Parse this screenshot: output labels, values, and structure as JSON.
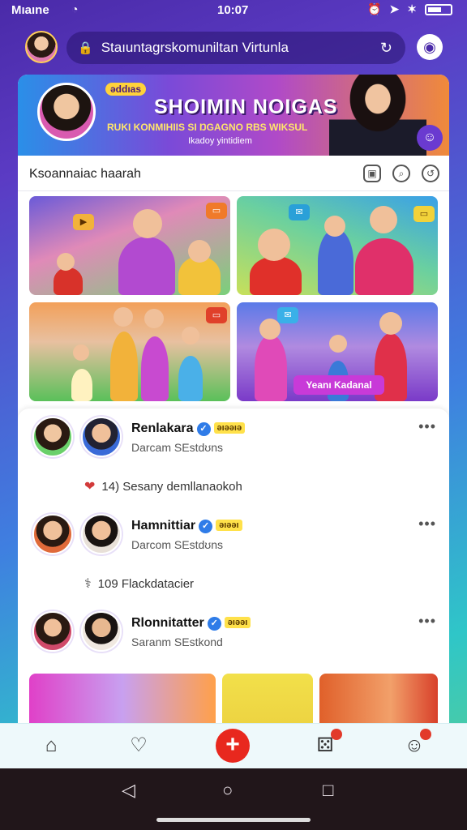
{
  "status_bar": {
    "carrier": "Mıaıne",
    "time": "10:07"
  },
  "top_bar": {
    "search_text": "Staıuntagrskomuniltan Virtunla"
  },
  "banner": {
    "brand_badge": "ǝddıas",
    "title": "SHOIMIN NOIGAS",
    "subtitle": "RUKI KONMIHIIS SI ŊGAGNO RBS WIKSUL",
    "tagline": "Ikadoy yintidiem"
  },
  "section": {
    "label": "Ksoannaiac haarah"
  },
  "tiles": [
    {
      "caption": ""
    },
    {
      "caption": ""
    },
    {
      "caption": ""
    },
    {
      "caption": "Yeanı Kadanal"
    }
  ],
  "posts": [
    {
      "name": "Renlakara",
      "tag": "ǝıǝəıǝ",
      "meta": "Darcam SEstdʊns",
      "stat": "14) Sesany demllanaokoh"
    },
    {
      "name": "Hamnittiar",
      "tag": "ǝıǝəı",
      "meta": "Darcom SEstdʊns",
      "stat": "109 Flackdatacier"
    },
    {
      "name": "Rlonnitatter",
      "tag": "ǝıǝəı",
      "meta": "Saranm SEstkond",
      "stat": ""
    }
  ],
  "colors": {
    "accent": "#4a2aa8",
    "add_button": "#e8281e",
    "verified": "#2f7ce8",
    "tag": "#ffe14a"
  },
  "icons": {
    "status": [
      "wifi-icon",
      "alarm-icon",
      "location-arrow-icon",
      "signal-icon",
      "battery-icon"
    ],
    "nav": [
      "home-icon",
      "chat-heart-icon",
      "add-icon",
      "dice-icon",
      "profile-icon"
    ],
    "system": [
      "back-icon",
      "home-circle-icon",
      "recents-icon"
    ]
  }
}
